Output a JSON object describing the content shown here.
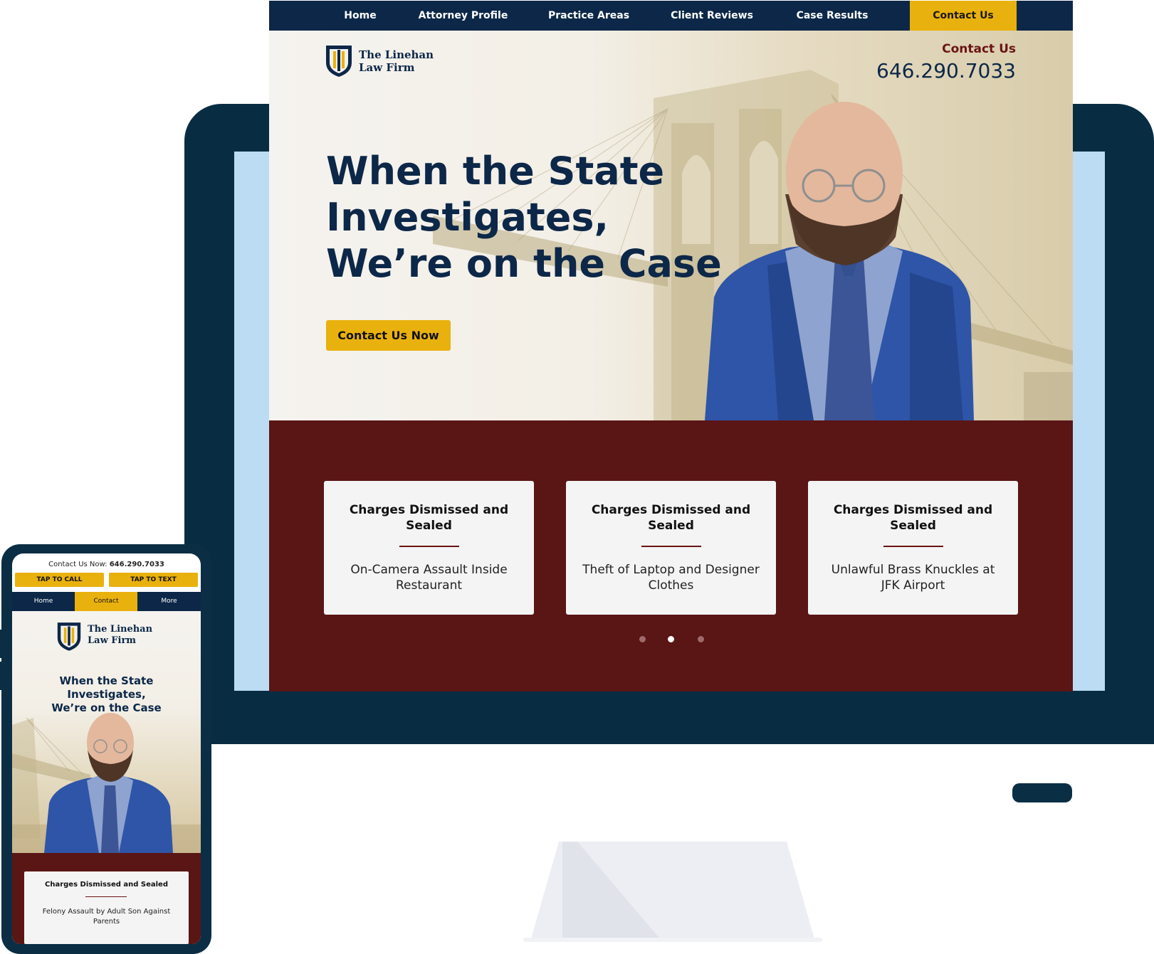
{
  "desktop": {
    "nav": [
      "Home",
      "Attorney Profile",
      "Practice Areas",
      "Client Reviews",
      "Case Results",
      "Contact Us"
    ],
    "active_nav": "Contact Us",
    "logo": {
      "line1": "The Linehan",
      "line2": "Law Firm"
    },
    "contact_label": "Contact Us",
    "phone": "646.290.7033",
    "headline": [
      "When the State",
      "Investigates,",
      "We’re on the Case"
    ],
    "cta": "Contact Us Now",
    "results": [
      {
        "title": "Charges Dismissed and Sealed",
        "desc": "On-Camera Assault Inside Restaurant"
      },
      {
        "title": "Charges Dismissed and Sealed",
        "desc": "Theft of Laptop and Designer Clothes"
      },
      {
        "title": "Charges Dismissed and Sealed",
        "desc": "Unlawful Brass Knuckles at JFK Airport"
      }
    ],
    "carousel_active_index": 1
  },
  "mobile": {
    "contact_prefix": "Contact Us Now:",
    "phone": "646.290.7033",
    "call_label": "TAP TO CALL",
    "text_label": "TAP TO TEXT",
    "nav": [
      "Home",
      "Contact",
      "More"
    ],
    "active_nav": "Contact",
    "logo": {
      "line1": "The Linehan",
      "line2": "Law Firm"
    },
    "headline": [
      "When the State Investigates,",
      "We’re on the Case"
    ],
    "result": {
      "title": "Charges Dismissed and Sealed",
      "desc": "Felony Assault by Adult Son Against Parents"
    }
  },
  "colors": {
    "navy": "#0c2748",
    "gold": "#e9b10d",
    "maroon": "#5a1515",
    "monitor": "#082d43",
    "screen_bezel": "#bcdcf4"
  }
}
